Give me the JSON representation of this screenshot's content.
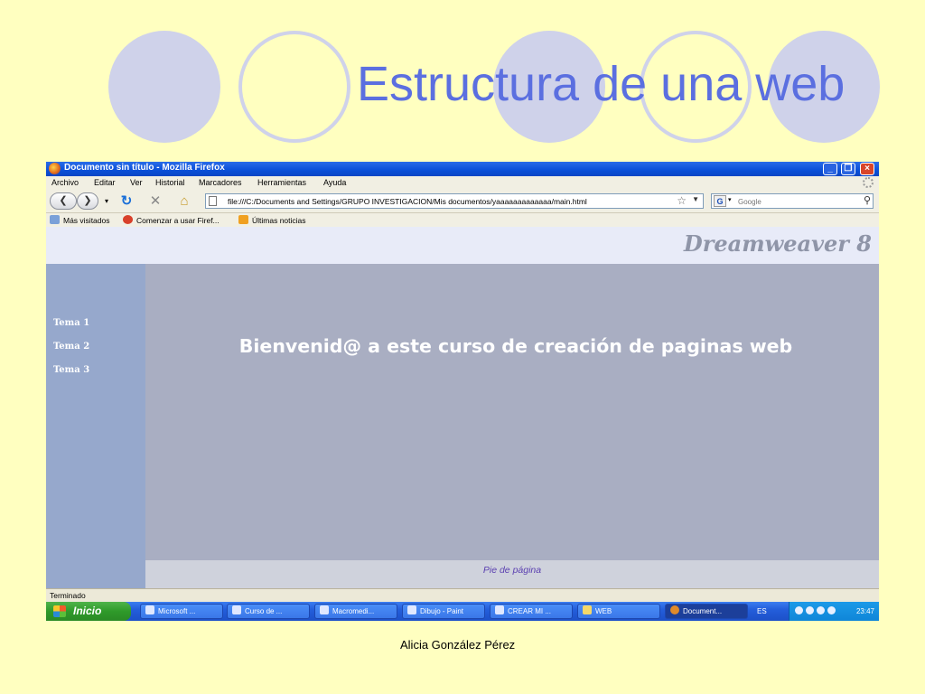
{
  "slide": {
    "title": "Estructura de una web",
    "author": "Alicia González Pérez"
  },
  "browser": {
    "window_title": "Documento sin título - Mozilla Firefox",
    "menu": [
      "Archivo",
      "Editar",
      "Ver",
      "Historial",
      "Marcadores",
      "Herramientas",
      "Ayuda"
    ],
    "url": "file:///C:/Documents and Settings/GRUPO INVESTIGACION/Mis documentos/yaaaaaaaaaaaaa/main.html",
    "search_placeholder": "Google",
    "bookmarks": [
      "Más visitados",
      "Comenzar a usar Firef...",
      "Últimas noticias"
    ],
    "status": "Terminado"
  },
  "page": {
    "logo_text": "Dreamweaver 8",
    "nav": [
      "Tema 1",
      "Tema 2",
      "Tema 3"
    ],
    "welcome": "Bienvenid@ a este curso de creación de paginas web",
    "footer": "Pie de página"
  },
  "taskbar": {
    "start_label": "Inicio",
    "tasks": [
      "Microsoft ...",
      "Curso de ...",
      "Macromedi...",
      "Dibujo - Paint",
      "CREAR MI ...",
      "WEB",
      "Document..."
    ],
    "language": "ES",
    "clock": "23:47"
  },
  "colors": {
    "slide_background": "#ffffc0",
    "title_color": "#5b6fe0",
    "circle_color": "#cfd2ea",
    "content_background": "#a9aec2",
    "leftnav_background": "#96a8cc"
  }
}
